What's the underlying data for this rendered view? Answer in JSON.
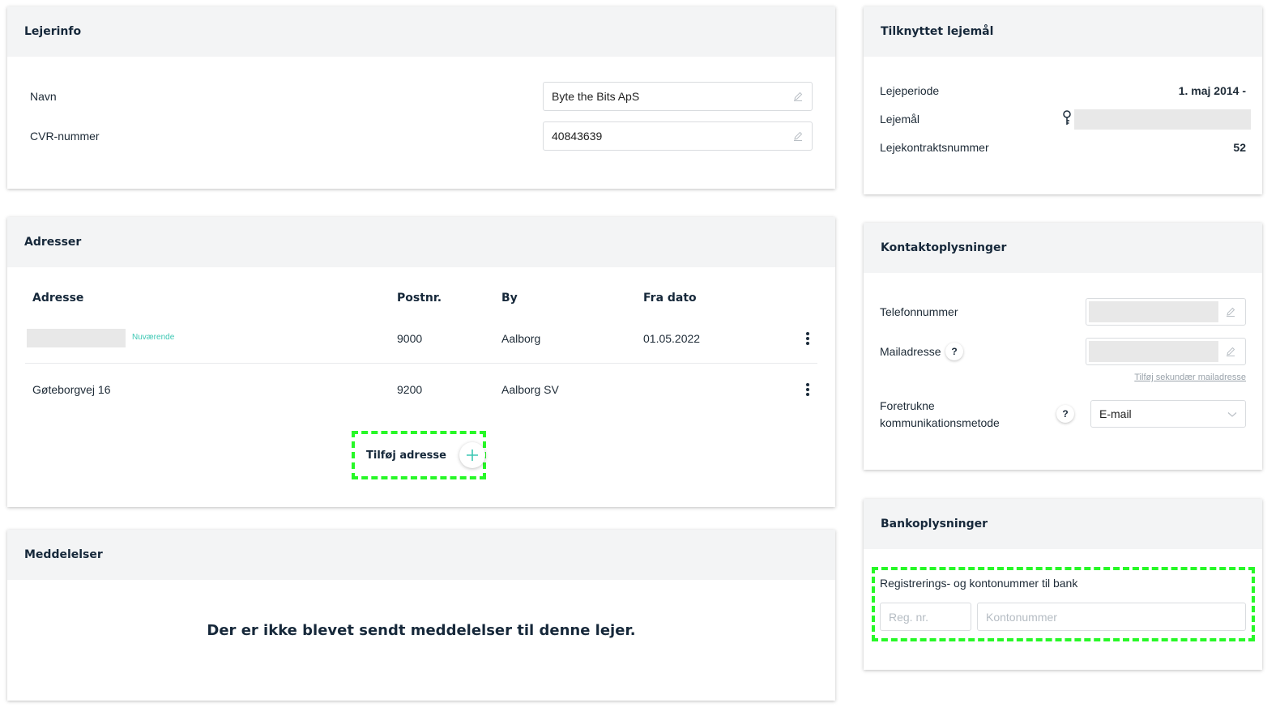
{
  "lejerinfo": {
    "title": "Lejerinfo",
    "navn_label": "Navn",
    "navn_value": "Byte the Bits ApS",
    "cvr_label": "CVR-nummer",
    "cvr_value": "40843639"
  },
  "tilknyttet": {
    "title": "Tilknyttet lejemål",
    "lejeperiode_label": "Lejeperiode",
    "lejeperiode_value": "1. maj 2014 -",
    "lejemaal_label": "Lejemål",
    "kontrakt_label": "Lejekontraktsnummer",
    "kontrakt_value": "52"
  },
  "adresser": {
    "title": "Adresser",
    "headers": {
      "adresse": "Adresse",
      "postnr": "Postnr.",
      "by": "By",
      "fra_dato": "Fra dato"
    },
    "rows": [
      {
        "adresse": "",
        "badge": "Nuværende",
        "postnr": "9000",
        "by": "Aalborg",
        "fra_dato": "01.05.2022"
      },
      {
        "adresse": "Gøteborgvej 16",
        "badge": "",
        "postnr": "9200",
        "by": "Aalborg SV",
        "fra_dato": ""
      }
    ],
    "add_label": "Tilføj adresse"
  },
  "meddelelser": {
    "title": "Meddelelser",
    "empty_text": "Der er ikke blevet sendt meddelelser til denne lejer."
  },
  "kontakt": {
    "title": "Kontaktoplysninger",
    "telefon_label": "Telefonnummer",
    "mail_label": "Mailadresse",
    "mail_help": "?",
    "secondary_link": "Tilføj sekundær mailadresse",
    "metode_label_line1": "Foretrukne",
    "metode_label_line2": "kommunikationsmetode",
    "metode_help": "?",
    "metode_value": "E-mail"
  },
  "bank": {
    "title": "Bankoplysninger",
    "label": "Registrerings- og kontonummer til bank",
    "reg_placeholder": "Reg. nr.",
    "konto_placeholder": "Kontonummer"
  },
  "colors": {
    "accent": "#3cc7b3",
    "highlight": "#27f827",
    "header_bg": "#f3f4f5"
  },
  "icons": [
    "pencil-icon",
    "key-icon",
    "kebab-icon",
    "plus-icon",
    "chevron-down-icon",
    "help-icon"
  ]
}
